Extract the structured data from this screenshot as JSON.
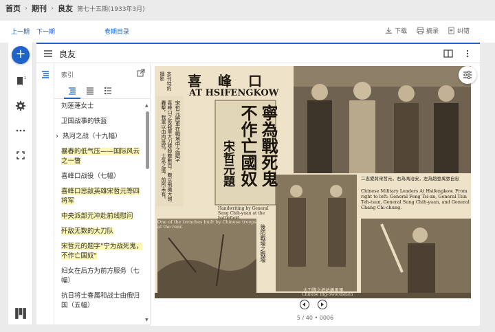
{
  "breadcrumb": {
    "home": "首页",
    "journals": "期刊",
    "journal": "良友",
    "issue": "第七十五期(1933年3月)"
  },
  "topbar": {
    "prev": "上一期",
    "next": "下一期",
    "toc": "卷期目录",
    "download": "下载",
    "excerpt": "摘录",
    "report": "纠错"
  },
  "viewer": {
    "title": "良友"
  },
  "panel": {
    "label": "索引",
    "items": [
      {
        "text": "刘莲蓬女士",
        "highlight": false,
        "arrow": false
      },
      {
        "text": "卫国战事的铁盔",
        "highlight": false,
        "arrow": false
      },
      {
        "text": "热河之战（十九幅）",
        "highlight": false,
        "arrow": true
      },
      {
        "text": "暴春的低气压——国际风云之一瞥",
        "highlight": true,
        "arrow": false
      },
      {
        "text": "喜峰口战役（七幅）",
        "highlight": false,
        "arrow": false
      },
      {
        "text": "喜峰口惩敌英雄宋哲元等四将军",
        "highlight": true,
        "arrow": false
      },
      {
        "text": "中央派部元冲赴前线慰问",
        "highlight": true,
        "arrow": false
      },
      {
        "text": "歼敌无数的大刀队",
        "highlight": true,
        "arrow": false
      },
      {
        "text": "宋哲元的题字\"宁为战死鬼，不作亡国奴\"",
        "highlight": true,
        "arrow": false
      },
      {
        "text": "妇女在后方为前方服务（七幅）",
        "highlight": false,
        "arrow": false
      },
      {
        "text": "抗日将士眷属和战士由俄归国（五幅）",
        "highlight": false,
        "arrow": false
      }
    ]
  },
  "page": {
    "headline_cn": "喜峰口",
    "headline_en": "AT HSIFENGKOW",
    "calligraphy": [
      "寧為戰死鬼",
      "不作亡國奴",
      "宋哲元題"
    ],
    "side_note": "本刊特約攝影",
    "body_col1": "宋哲元將軍在戰地中之題字",
    "body_col2": "喜峰口之役我軍大刀隊殺敵數百，敵以飛機大炮轟擊，我軍以血肉抵抗，士氣之盛，前所未有。",
    "caption_hand": "Handwriting by General Sung Chih-yuan at the battlefield.",
    "caption_trench": "One of the trenches built by Chinese troops at the rear.",
    "caption_trench_cn": "後防戰壕之戰壕",
    "caption_leaders_cn": "二忠愛將宋哲元，右為馮治安，左為趙登禹張自忠",
    "caption_leaders_en": "Chinese Military Leaders At Hsifengkow. From right to left: General Feng Tsi-an, General Tsin Teh-tsun, General Sung Chih-yuan, and General Chang Chi-chung.",
    "caption_sword_cn": "大刀隊之抵抗義勇軍",
    "caption_sword_en": "Chinese Big-Swordsmen"
  },
  "pageinfo": "5 / 40 • 0006"
}
